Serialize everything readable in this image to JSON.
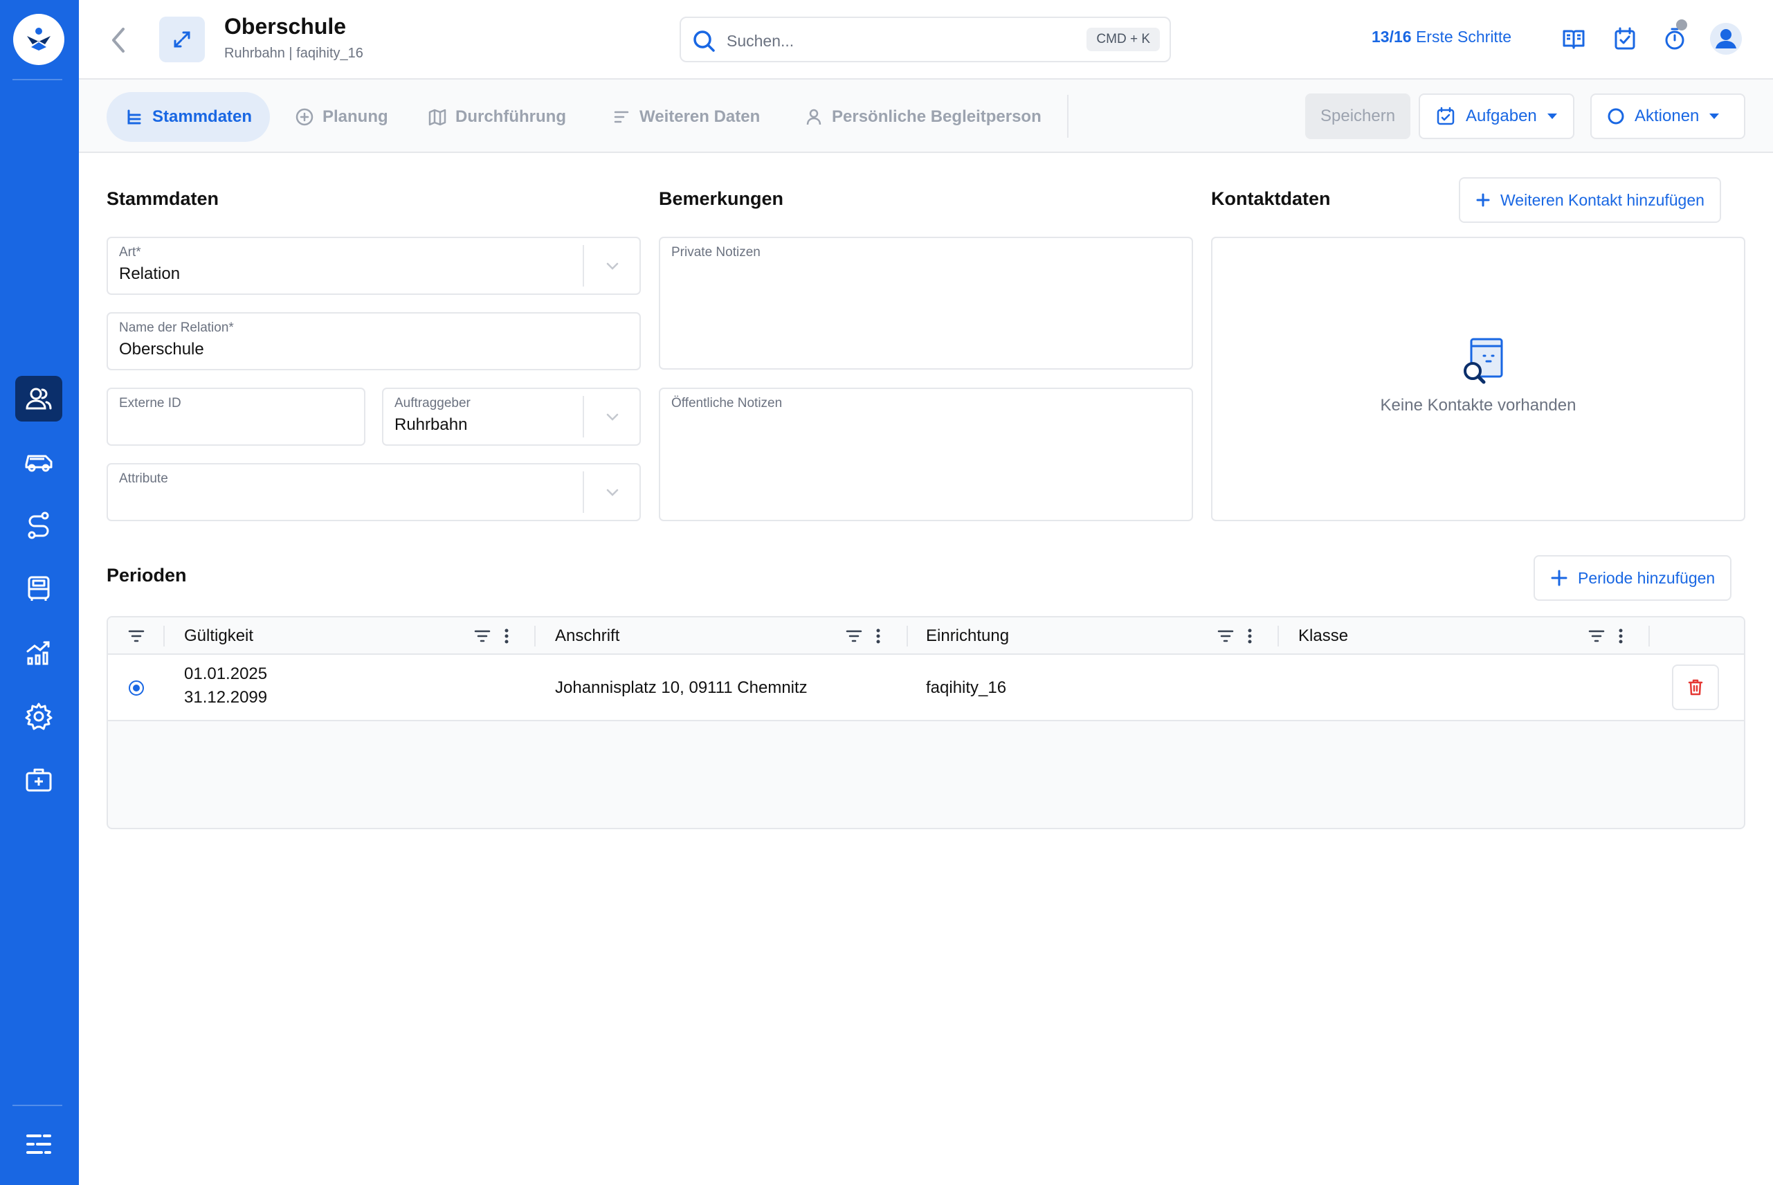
{
  "colors": {
    "brand": "#1967e3",
    "sidebar_active": "#0b2f6b",
    "danger": "#e53935"
  },
  "sidebar": {
    "items": [
      {
        "icon": "users-icon",
        "active": true
      },
      {
        "icon": "vehicle-icon",
        "active": false
      },
      {
        "icon": "route-icon",
        "active": false
      },
      {
        "icon": "bus-icon",
        "active": false
      },
      {
        "icon": "analytics-icon",
        "active": false
      },
      {
        "icon": "settings-icon",
        "active": false
      },
      {
        "icon": "medical-case-icon",
        "active": false
      }
    ],
    "bottom_icon": "menu-icon"
  },
  "header": {
    "title": "Oberschule",
    "subtitle": "Ruhrbahn | faqihity_16",
    "search_placeholder": "Suchen...",
    "search_shortcut": "CMD + K",
    "steps_count": "13/16",
    "steps_label": "Erste Schritte"
  },
  "tabs": [
    {
      "label": "Stammdaten",
      "active": true
    },
    {
      "label": "Planung",
      "active": false
    },
    {
      "label": "Durchführung",
      "active": false
    },
    {
      "label": "Weiteren Daten",
      "active": false
    },
    {
      "label": "Persönliche Begleitperson",
      "active": false
    }
  ],
  "toolbar": {
    "save": "Speichern",
    "tasks": "Aufgaben",
    "actions": "Aktionen"
  },
  "stammdaten": {
    "title": "Stammdaten",
    "art": {
      "label": "Art*",
      "value": "Relation"
    },
    "name": {
      "label": "Name der Relation*",
      "value": "Oberschule"
    },
    "external_id": {
      "label": "Externe ID",
      "value": ""
    },
    "client": {
      "label": "Auftraggeber",
      "value": "Ruhrbahn"
    },
    "attribute": {
      "label": "Attribute",
      "value": ""
    }
  },
  "bemerkungen": {
    "title": "Bemerkungen",
    "private_label": "Private Notizen",
    "public_label": "Öffentliche Notizen"
  },
  "kontaktdaten": {
    "title": "Kontaktdaten",
    "add_button": "Weiteren Kontakt hinzufügen",
    "empty_text": "Keine Kontakte vorhanden"
  },
  "perioden": {
    "title": "Perioden",
    "add_button": "Periode hinzufügen",
    "columns": [
      "Gültigkeit",
      "Anschrift",
      "Einrichtung",
      "Klasse"
    ],
    "rows": [
      {
        "valid_from": "01.01.2025",
        "valid_to": "31.12.2099",
        "address": "Johannisplatz 10, 09111 Chemnitz",
        "facility": "faqihity_16",
        "class": "",
        "selected": true
      }
    ]
  }
}
